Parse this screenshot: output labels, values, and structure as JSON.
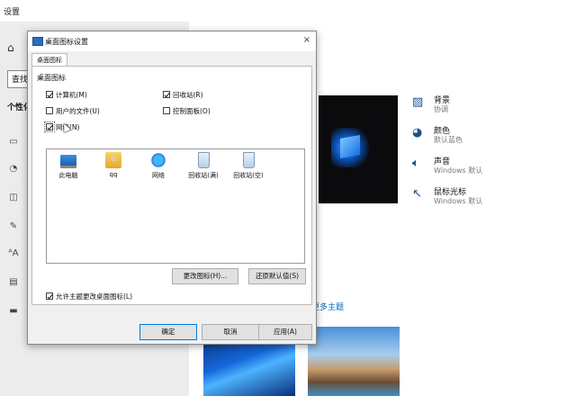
{
  "settings": {
    "window_title": "设置",
    "search_placeholder": "查找",
    "section_head": "个性化",
    "nav_icons": [
      "image-icon",
      "palette-icon",
      "window-icon",
      "pen-icon",
      "font-icon",
      "start-icon",
      "taskbar-icon"
    ],
    "options": [
      {
        "title": "背景",
        "subtitle": "协调",
        "icon": "picture-icon"
      },
      {
        "title": "颜色",
        "subtitle": "默认蓝色",
        "icon": "palette-icon"
      },
      {
        "title": "声音",
        "subtitle": "Windows 默认",
        "icon": "speaker-icon"
      },
      {
        "title": "鼠标光标",
        "subtitle": "Windows 默认",
        "icon": "cursor-icon"
      }
    ],
    "more_themes": "更多主题"
  },
  "dialog": {
    "title": "桌面图标设置",
    "tab": "桌面图标",
    "group_label": "桌面图标",
    "checkboxes": [
      {
        "label": "计算机(M)",
        "checked": true
      },
      {
        "label": "回收站(R)",
        "checked": true
      },
      {
        "label": "用户的文件(U)",
        "checked": false
      },
      {
        "label": "控制面板(O)",
        "checked": false
      },
      {
        "label": "网络(N)",
        "checked": true
      }
    ],
    "icons": [
      {
        "label": "此电脑",
        "icon": "computer-icon"
      },
      {
        "label": "qq",
        "icon": "user-folder-icon"
      },
      {
        "label": "网络",
        "icon": "network-icon"
      },
      {
        "label": "回收站(满)",
        "icon": "recycle-bin-full-icon"
      },
      {
        "label": "回收站(空)",
        "icon": "recycle-bin-empty-icon"
      }
    ],
    "change_icon": "更改图标(H)...",
    "restore_default": "还原默认值(S)",
    "allow_themes": "允许主题更改桌面图标(L)",
    "allow_themes_checked": true,
    "ok": "确定",
    "cancel": "取消",
    "apply": "应用(A)"
  }
}
